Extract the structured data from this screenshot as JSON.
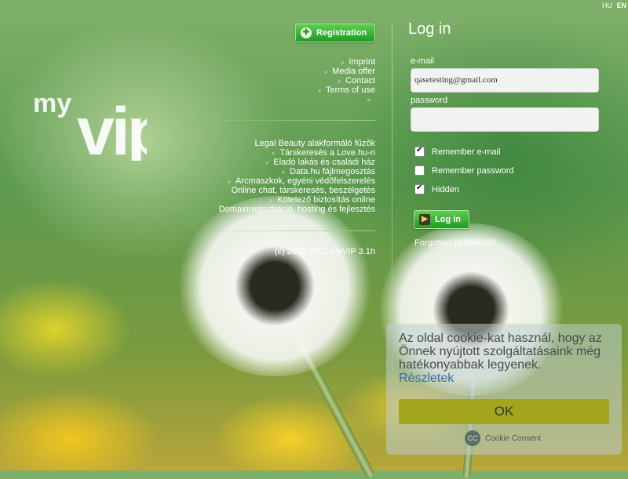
{
  "lang": {
    "hu": "HU",
    "en": "EN"
  },
  "logo": {
    "text": "myVIP"
  },
  "registration": {
    "label": "Registration"
  },
  "links": [
    "Imprint",
    "Media offer",
    "Contact",
    "Terms of use",
    ""
  ],
  "promo": [
    "Legal Beauty alakformáló fűzők",
    "Társkeresés a Love.hu-n",
    "Eladó lakás és családi ház",
    "Data.hu fájlmegosztás",
    "Arcmaszkok, egyéni védőfelszerelés",
    "Online chat, társkeresés, beszélgetés",
    "Kötelező biztosítás online",
    "Domainregisztráció, hosting és fejlesztés"
  ],
  "copyright": "(c) 2006-2021 myVIP 3.1h",
  "login": {
    "title": "Log in",
    "email_label": "e-mail",
    "email_value": "qasetesting@gmail.com",
    "password_label": "password",
    "password_value": "",
    "remember_email": "Remember e-mail",
    "remember_password": "Remember password",
    "hidden": "Hidden",
    "button": "Log in",
    "forgot": "Forgotten password?"
  },
  "checkboxes": {
    "remember_email": true,
    "remember_password": false,
    "hidden": true
  },
  "cookie": {
    "message": "Az oldal cookie-kat használ, hogy az Önnek nyújtott szolgáltatásaink még hatékonyabbak legyenek.",
    "details": "Részletek",
    "ok": "OK",
    "brand": "Cookie Consent"
  },
  "colors": {
    "accent_green": "#1f9a22",
    "cookie_button": "#a2a61d",
    "link_blue": "#3a6ea5"
  }
}
